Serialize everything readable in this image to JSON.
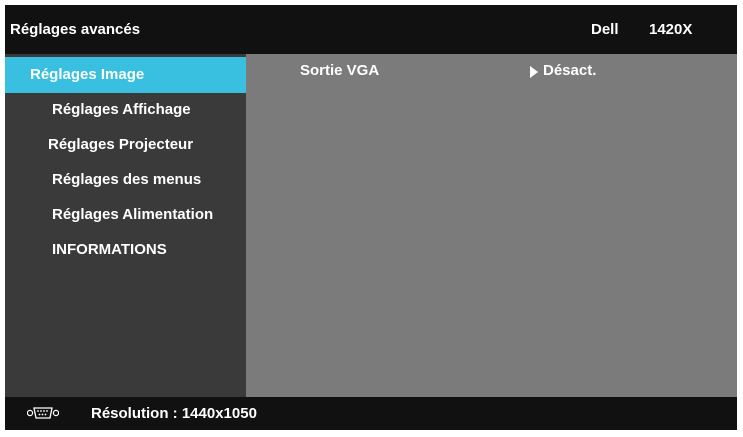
{
  "header": {
    "title": "Réglages avancés",
    "brand": "Dell",
    "model": "1420X"
  },
  "sidebar": {
    "items": [
      {
        "label": "Réglages Image",
        "selected": true
      },
      {
        "label": "Réglages Affichage",
        "selected": false
      },
      {
        "label": "Réglages Projecteur",
        "selected": false
      },
      {
        "label": "Réglages des menus",
        "selected": false
      },
      {
        "label": "Réglages Alimentation",
        "selected": false
      },
      {
        "label": "INFORMATIONS",
        "selected": false
      }
    ]
  },
  "content": {
    "option": {
      "label": "Sortie VGA",
      "value": "Désact."
    }
  },
  "status": {
    "icon": "vga-connector-icon",
    "text": "Résolution : 1440x1050"
  },
  "colors": {
    "selected_bg": "#39c0e0",
    "bar_bg": "#111111",
    "sidebar_bg": "#3a3a3a",
    "content_bg": "#7b7b7b"
  }
}
